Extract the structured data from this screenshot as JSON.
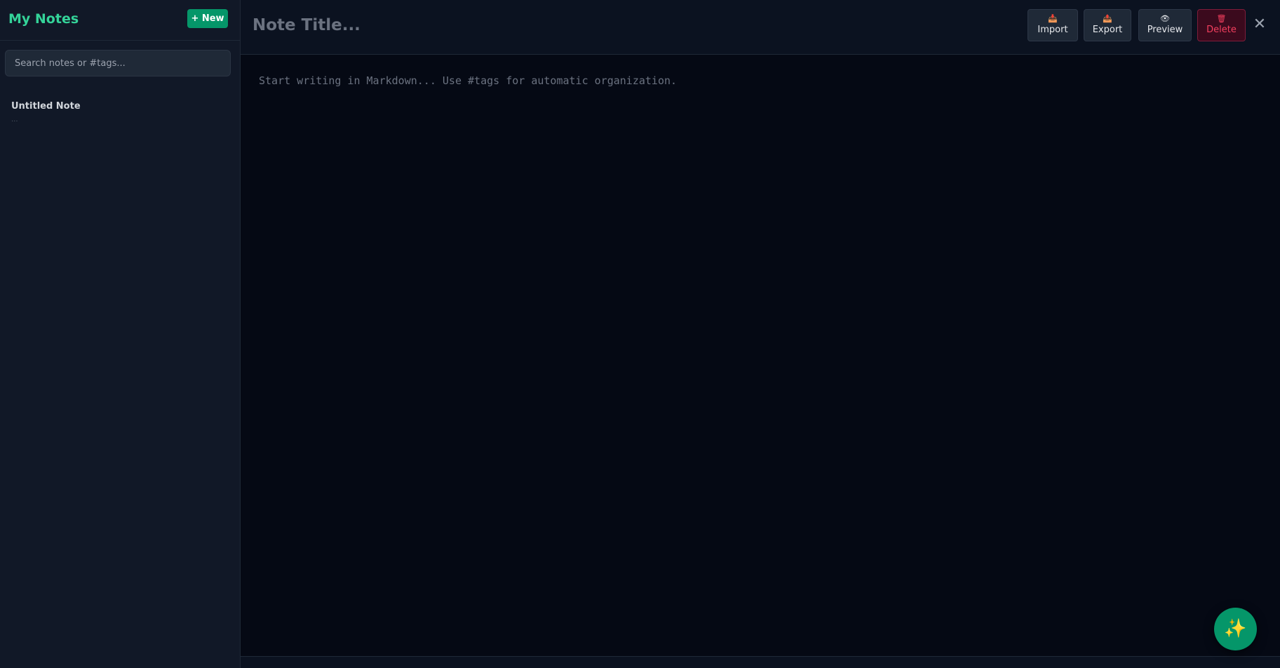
{
  "sidebar": {
    "title": "My Notes",
    "new_button_label": "+ New",
    "search": {
      "placeholder": "Search notes or #tags...",
      "value": ""
    },
    "notes": [
      {
        "title": "Untitled Note",
        "preview": "..."
      }
    ]
  },
  "editor": {
    "title_placeholder": "Note Title...",
    "title_value": "",
    "body_placeholder": "Start writing in Markdown... Use #tags for automatic organization.",
    "body_value": ""
  },
  "toolbar": {
    "import": {
      "icon": "📥",
      "label": "Import",
      "icon_name": "import-icon"
    },
    "export": {
      "icon": "📤",
      "label": "Export",
      "icon_name": "export-icon"
    },
    "preview": {
      "icon": "👁",
      "label": "Preview",
      "icon_name": "eye-icon"
    },
    "delete": {
      "icon": "🗑",
      "label": "Delete",
      "icon_name": "trash-icon"
    },
    "close_glyph": "✕"
  },
  "fab": {
    "glyph": "✨",
    "icon_name": "sparkles-icon"
  },
  "colors": {
    "accent": "#34d399",
    "accent_button": "#059669",
    "danger": "#f43f5e",
    "sidebar_bg": "#111827",
    "editor_bg": "#050914"
  }
}
